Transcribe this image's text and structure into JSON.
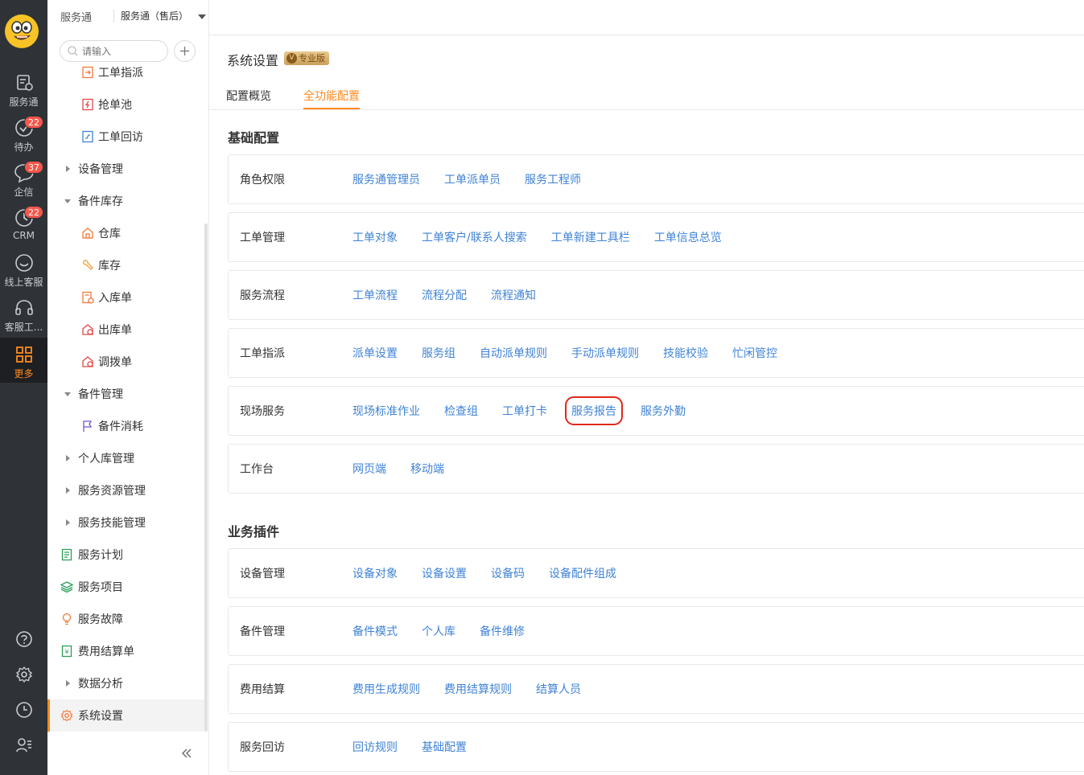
{
  "rail": {
    "items": [
      {
        "label": "服务通",
        "icon": "service-icon"
      },
      {
        "label": "待办",
        "icon": "todo-icon",
        "badge": "22"
      },
      {
        "label": "企信",
        "icon": "chat-icon",
        "badge": "37"
      },
      {
        "label": "CRM",
        "icon": "crm-icon",
        "badge": "22"
      },
      {
        "label": "线上客服",
        "icon": "online-service-icon"
      },
      {
        "label": "客服工...",
        "icon": "headset-icon"
      },
      {
        "label": "更多",
        "icon": "grid-icon"
      }
    ],
    "bottom_icons": [
      "help-icon",
      "settings-icon",
      "clock-icon",
      "user-list-icon"
    ]
  },
  "header": {
    "app_name": "服务通",
    "app_selector": "服务通（售后）"
  },
  "sidebar": {
    "search_placeholder": "请输入",
    "items": [
      {
        "label": "工单指派",
        "level": 2
      },
      {
        "label": "抢单池",
        "level": 2
      },
      {
        "label": "工单回访",
        "level": 2
      },
      {
        "label": "设备管理",
        "level": 1,
        "expand": "collapsed"
      },
      {
        "label": "备件库存",
        "level": 1,
        "expand": "expanded"
      },
      {
        "label": "仓库",
        "level": 2
      },
      {
        "label": "库存",
        "level": 2
      },
      {
        "label": "入库单",
        "level": 2
      },
      {
        "label": "出库单",
        "level": 2
      },
      {
        "label": "调拨单",
        "level": 2
      },
      {
        "label": "备件管理",
        "level": 1,
        "expand": "expanded"
      },
      {
        "label": "备件消耗",
        "level": 2
      },
      {
        "label": "个人库管理",
        "level": 1,
        "expand": "collapsed"
      },
      {
        "label": "服务资源管理",
        "level": 1,
        "expand": "collapsed"
      },
      {
        "label": "服务技能管理",
        "level": 1,
        "expand": "collapsed"
      },
      {
        "label": "服务计划",
        "level": 1
      },
      {
        "label": "服务项目",
        "level": 1
      },
      {
        "label": "服务故障",
        "level": 1
      },
      {
        "label": "费用结算单",
        "level": 1
      },
      {
        "label": "数据分析",
        "level": 1,
        "expand": "collapsed"
      },
      {
        "label": "系统设置",
        "level": 1,
        "active": true
      }
    ]
  },
  "main": {
    "title": "系统设置",
    "badge": "专业版",
    "tabs": [
      {
        "label": "配置概览"
      },
      {
        "label": "全功能配置",
        "active": true
      }
    ],
    "sections": [
      {
        "title": "基础配置",
        "rows": [
          {
            "name": "角色权限",
            "links": [
              "服务通管理员",
              "工单派单员",
              "服务工程师"
            ]
          },
          {
            "name": "工单管理",
            "links": [
              "工单对象",
              "工单客户/联系人搜索",
              "工单新建工具栏",
              "工单信息总览"
            ]
          },
          {
            "name": "服务流程",
            "links": [
              "工单流程",
              "流程分配",
              "流程通知"
            ]
          },
          {
            "name": "工单指派",
            "links": [
              "派单设置",
              "服务组",
              "自动派单规则",
              "手动派单规则",
              "技能校验",
              "忙闲管控"
            ]
          },
          {
            "name": "现场服务",
            "links": [
              "现场标准作业",
              "检查组",
              "工单打卡",
              "服务报告",
              "服务外勤"
            ],
            "highlight": "服务报告"
          },
          {
            "name": "工作台",
            "links": [
              "网页端",
              "移动端"
            ]
          }
        ]
      },
      {
        "title": "业务插件",
        "rows": [
          {
            "name": "设备管理",
            "links": [
              "设备对象",
              "设备设置",
              "设备码",
              "设备配件组成"
            ]
          },
          {
            "name": "备件管理",
            "links": [
              "备件模式",
              "个人库",
              "备件维修"
            ]
          },
          {
            "name": "费用结算",
            "links": [
              "费用生成规则",
              "费用结算规则",
              "结算人员"
            ]
          },
          {
            "name": "服务回访",
            "links": [
              "回访规则",
              "基础配置"
            ]
          }
        ]
      }
    ]
  },
  "colors": {
    "rail_bg": "#2f3237",
    "accent": "#ff8a1f",
    "link": "#3f83d6",
    "highlight_border": "#e0281c",
    "badge": "#f5574b"
  }
}
